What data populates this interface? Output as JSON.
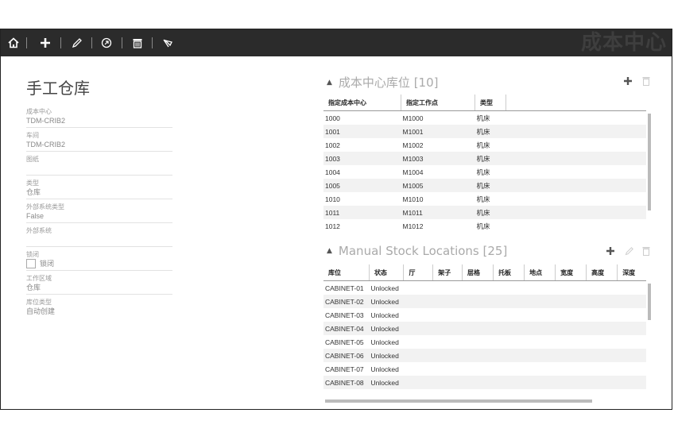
{
  "toolbar": {
    "icons": [
      "home-icon",
      "plus-icon",
      "pencil-icon",
      "copy-icon",
      "trash-icon",
      "eraser-icon"
    ],
    "brand": "成本中心",
    "bg": "#2b2b2b"
  },
  "left": {
    "title": "手工仓库",
    "fields": [
      {
        "label": "成本中心",
        "value": "TDM-CRIB2"
      },
      {
        "label": "车间",
        "value": "TDM-CRIB2"
      },
      {
        "label": "图纸",
        "value": ""
      },
      {
        "label": "类型",
        "value": "仓库"
      },
      {
        "label": "外部系统类型",
        "value": "False"
      },
      {
        "label": "外部系统",
        "value": ""
      }
    ],
    "locked_label": "锁闭",
    "locked_checkbox_label": "锁闭",
    "fields2": [
      {
        "label": "工作区域",
        "value": "仓库"
      },
      {
        "label": "库位类型",
        "value": "自动创建"
      }
    ]
  },
  "cost_center_locations": {
    "title": "成本中心库位 [10]",
    "columns": [
      "指定成本中心",
      "指定工作点",
      "类型"
    ],
    "rows": [
      [
        "1000",
        "M1000",
        "机床"
      ],
      [
        "1001",
        "M1001",
        "机床"
      ],
      [
        "1002",
        "M1002",
        "机床"
      ],
      [
        "1003",
        "M1003",
        "机床"
      ],
      [
        "1004",
        "M1004",
        "机床"
      ],
      [
        "1005",
        "M1005",
        "机床"
      ],
      [
        "1010",
        "M1010",
        "机床"
      ],
      [
        "1011",
        "M1011",
        "机床"
      ],
      [
        "1012",
        "M1012",
        "机床"
      ]
    ]
  },
  "manual_stock_locations": {
    "title": "Manual Stock Locations [25]",
    "columns": [
      "库位",
      "状态",
      "厅",
      "架子",
      "层格",
      "托板",
      "地点",
      "宽度",
      "高度",
      "深度"
    ],
    "rows": [
      [
        "CABINET-01",
        "Unlocked"
      ],
      [
        "CABINET-02",
        "Unlocked"
      ],
      [
        "CABINET-03",
        "Unlocked"
      ],
      [
        "CABINET-04",
        "Unlocked"
      ],
      [
        "CABINET-05",
        "Unlocked"
      ],
      [
        "CABINET-06",
        "Unlocked"
      ],
      [
        "CABINET-07",
        "Unlocked"
      ],
      [
        "CABINET-08",
        "Unlocked"
      ]
    ]
  }
}
